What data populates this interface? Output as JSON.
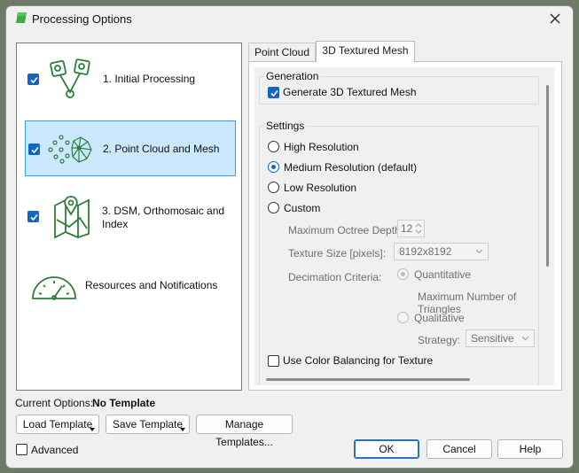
{
  "window": {
    "title": "Processing Options",
    "close_glyph": "✕",
    "accent": "#1565c0"
  },
  "steps": [
    {
      "label": "1. Initial Processing",
      "checked": true,
      "icon": "initial-processing-icon"
    },
    {
      "label": "2. Point Cloud and Mesh",
      "checked": true,
      "selected": true,
      "icon": "point-cloud-icon"
    },
    {
      "label_line1": "3. DSM, Orthomosaic and",
      "label_line2": "Index",
      "checked": true,
      "icon": "dsm-map-icon"
    },
    {
      "label": "Resources and Notifications",
      "icon": "gauge-icon"
    }
  ],
  "tabs": [
    {
      "label": "Point Cloud",
      "active": false
    },
    {
      "label": "3D Textured Mesh",
      "active": true
    }
  ],
  "generation": {
    "title": "Generation",
    "generate_label": "Generate 3D Textured Mesh",
    "generate_checked": true
  },
  "settings": {
    "title": "Settings",
    "options": [
      {
        "label": "High Resolution",
        "selected": false
      },
      {
        "label": "Medium Resolution (default)",
        "selected": true
      },
      {
        "label": "Low Resolution",
        "selected": false
      },
      {
        "label": "Custom",
        "selected": false
      }
    ],
    "octree_label": "Maximum Octree Depth:",
    "octree_value": "12",
    "texture_label": "Texture Size [pixels]:",
    "texture_value": "8192x8192",
    "decimation_label": "Decimation Criteria:",
    "quantitative_label": "Quantitative",
    "max_triangles_label": "Maximum Number of Triangles",
    "qualitative_label": "Qualitative",
    "strategy_label": "Strategy:",
    "strategy_value": "Sensitive",
    "color_balancing_label": "Use Color Balancing for Texture",
    "color_balancing_checked": false
  },
  "footer": {
    "current_options_label": "Current Options:",
    "current_options_value": "No Template",
    "load_template": "Load Template",
    "save_template": "Save Template",
    "manage_templates": "Manage Templates...",
    "advanced_label": "Advanced",
    "ok": "OK",
    "cancel": "Cancel",
    "help": "Help"
  }
}
